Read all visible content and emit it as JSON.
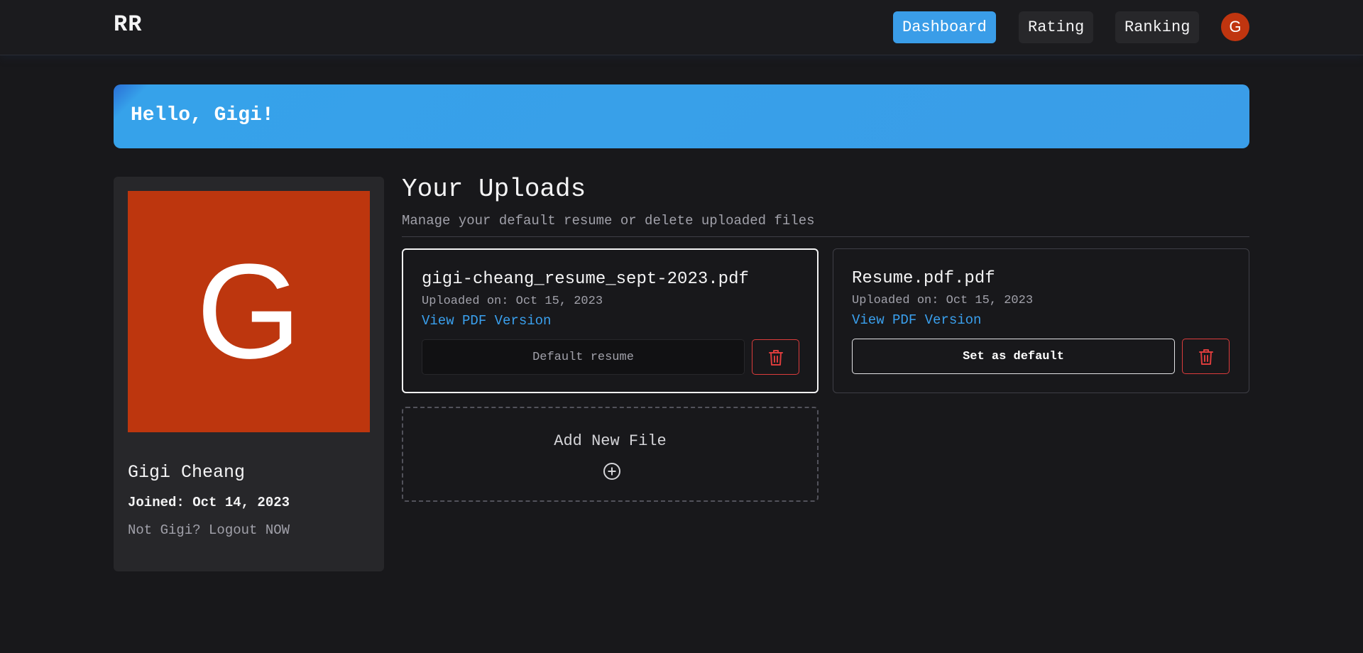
{
  "nav": {
    "brand": "RR",
    "items": [
      {
        "label": "Dashboard",
        "active": true
      },
      {
        "label": "Rating",
        "active": false
      },
      {
        "label": "Ranking",
        "active": false
      }
    ],
    "avatar_initial": "G",
    "avatar_color": "#c0350f"
  },
  "banner": {
    "greeting": "Hello, Gigi!",
    "color": "#3a9de8"
  },
  "profile": {
    "avatar_initial": "G",
    "avatar_color": "#bd360e",
    "name": "Gigi Cheang",
    "joined": "Joined: Oct 14, 2023",
    "logout_text": "Not Gigi? Logout NOW"
  },
  "uploads": {
    "title": "Your Uploads",
    "subtitle": "Manage your default resume or delete uploaded files",
    "files": [
      {
        "name": "gigi-cheang_resume_sept-2023.pdf",
        "uploaded": "Uploaded on: Oct 15, 2023",
        "link": "View PDF Version",
        "action": "Default resume",
        "is_default": true
      },
      {
        "name": "Resume.pdf.pdf",
        "uploaded": "Uploaded on: Oct 15, 2023",
        "link": "View PDF Version",
        "action": "Set as default",
        "is_default": false
      }
    ],
    "add_label": "Add New File",
    "add_icon": "plus-circle-icon",
    "trash_icon": "trash-icon",
    "danger_color": "#dc3c3c",
    "link_color": "#3aa0ee"
  }
}
